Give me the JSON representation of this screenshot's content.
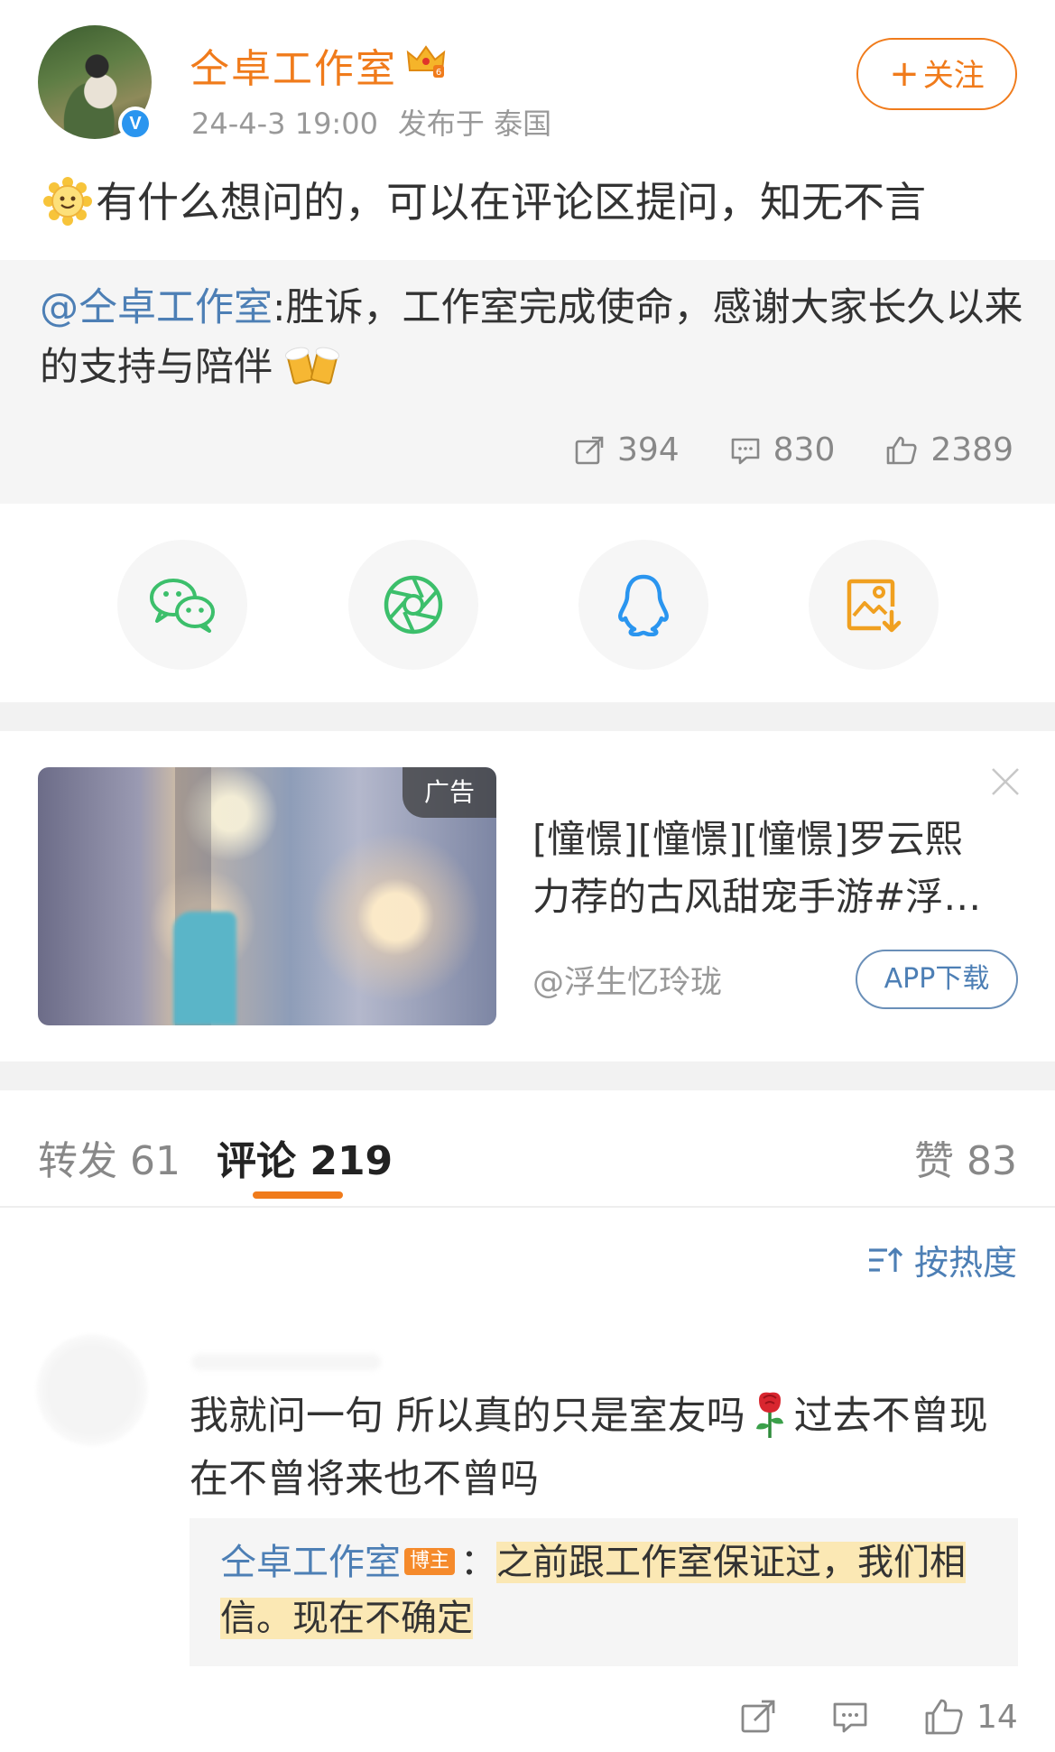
{
  "post": {
    "username": "仝卓工作室",
    "timestamp": "24-4-3 19:00",
    "location": "发布于 泰国",
    "follow_label": "关注",
    "text": "有什么想问的，可以在评论区提问，知无不言",
    "verified_mark": "V"
  },
  "quoted": {
    "mention": "@仝卓工作室",
    "text": ":胜诉，工作室完成使命，感谢大家长久以来的支持与陪伴",
    "reposts": "394",
    "comments": "830",
    "likes": "2389"
  },
  "share": {
    "items": [
      "wechat-icon",
      "moments-icon",
      "qq-icon",
      "save-image-icon"
    ],
    "colors": {
      "wechat": "#3cbf6b",
      "qq": "#2a95ef",
      "save": "#f0a020"
    }
  },
  "ad": {
    "tag": "广告",
    "title_line1": "[憧憬][憧憬][憧憬]罗云熙",
    "title_line2": "力荐的古风甜宠手游#浮…",
    "source": "@浮生忆玲珑",
    "cta": "APP下载"
  },
  "tabs": {
    "repost_label": "转发",
    "repost_count": "61",
    "comment_label": "评论",
    "comment_count": "219",
    "like_label": "赞",
    "like_count": "83"
  },
  "sort": {
    "label": "按热度"
  },
  "comment": {
    "text_part1": "我就问一句 所以真的只是室友吗",
    "text_part2": "过去不曾现在不曾将来也不曾吗",
    "reply_author": "仝卓工作室",
    "reply_badge": "博主",
    "reply_sep": "：",
    "reply_text": "之前跟工作室保证过，我们相信。现在不确定",
    "likes": "14"
  },
  "colors": {
    "accent": "#f07b1b",
    "link": "#4d7fb5",
    "muted": "#999999"
  }
}
